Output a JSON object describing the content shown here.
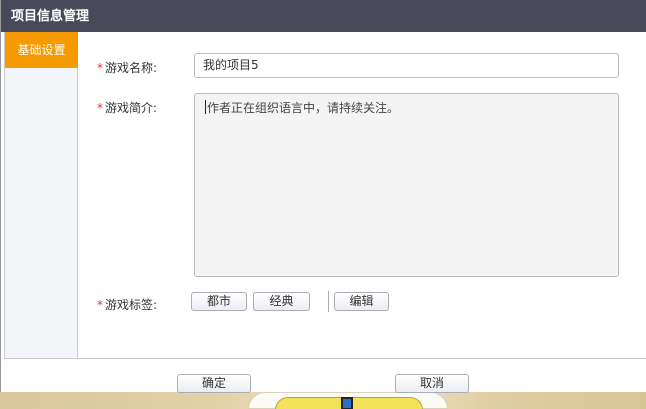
{
  "window": {
    "title": "项目信息管理"
  },
  "sidebar": {
    "tabs": [
      {
        "label": "基础设置",
        "active": true
      }
    ]
  },
  "form": {
    "required_mark": "*",
    "name": {
      "label": "游戏名称:",
      "value": "我的项目5"
    },
    "intro": {
      "label": "游戏简介:",
      "value": "作者正在组织语言中，请持续关注。"
    },
    "tags": {
      "label": "游戏标签:",
      "items": [
        "都市",
        "经典"
      ],
      "edit_label": "编辑"
    }
  },
  "footer": {
    "confirm_label": "确定",
    "cancel_label": "取消"
  },
  "colors": {
    "titlebar": "#484a5a",
    "active_tab": "#f59a00",
    "required": "#e03a3a"
  }
}
